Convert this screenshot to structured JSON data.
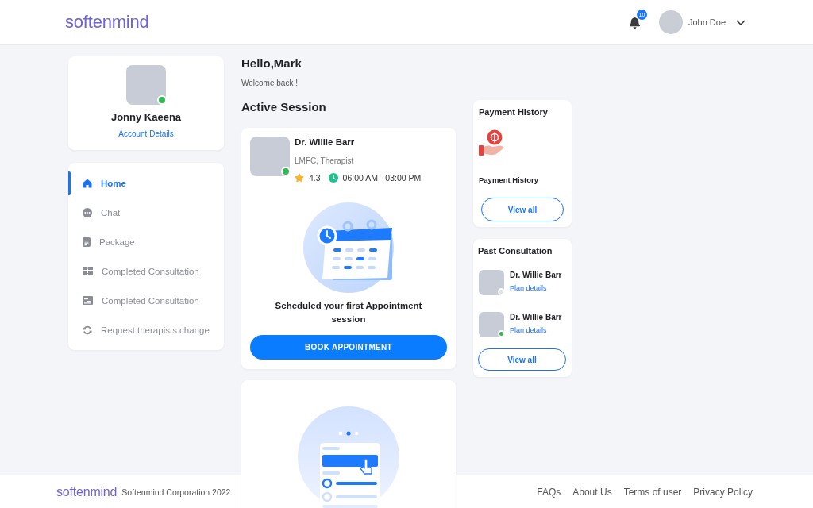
{
  "header": {
    "logo": "softenmind",
    "notification_count": "10",
    "user_name": "John Doe"
  },
  "profile": {
    "name": "Jonny Kaeena",
    "online": true,
    "link": "Account Details"
  },
  "nav": {
    "items": [
      {
        "label": "Home",
        "selected": true
      },
      {
        "label": "Chat",
        "selected": false
      },
      {
        "label": "Package",
        "selected": false
      },
      {
        "label": "Completed Consultation",
        "selected": false
      },
      {
        "label": "Completed Consultation",
        "selected": false
      },
      {
        "label": "Request therapists change",
        "selected": false
      }
    ]
  },
  "greeting": {
    "title": "Hello,Mark",
    "subtitle": "Welcome back !"
  },
  "active_session": {
    "title": "Active Session",
    "therapist": {
      "name": "Dr. Willie Barr",
      "role": "LMFC, Therapist",
      "online": true,
      "rating": "4.3",
      "hours": "06:00 AM - 03:00 PM"
    },
    "message": "Scheduled your first Appointment session",
    "button": "BOOK APPOINTMENT"
  },
  "payment_history": {
    "title": "Payment History",
    "label": "Payment History",
    "button": "View all"
  },
  "past_consultation": {
    "title": "Past Consultation",
    "items": [
      {
        "name": "Dr. Willie Barr",
        "link": "Plan details",
        "online": false
      },
      {
        "name": "Dr. Willie Barr",
        "link": "Plan details",
        "online": true
      }
    ],
    "button": "View all"
  },
  "footer": {
    "logo": "softenmind",
    "copyright": "Softenmind Corporation 2022",
    "links": [
      "FAQs",
      "About Us",
      "Terms of user",
      "Privacy Policy"
    ]
  }
}
